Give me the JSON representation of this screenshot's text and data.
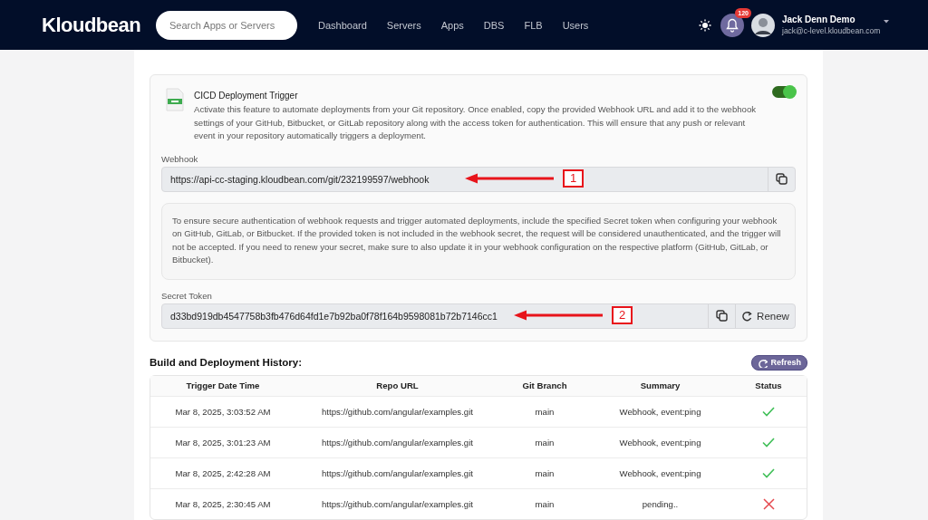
{
  "header": {
    "logo": "Kloudbean",
    "search": {
      "placeholder": "Search Apps or Servers"
    },
    "nav": [
      {
        "label": "Dashboard"
      },
      {
        "label": "Servers"
      },
      {
        "label": "Apps"
      },
      {
        "label": "DBS"
      },
      {
        "label": "FLB"
      },
      {
        "label": "Users"
      }
    ],
    "notifications": {
      "count": "120"
    },
    "user": {
      "name": "Jack Denn Demo",
      "email": "jack@c-level.kloudbean.com"
    }
  },
  "trigger": {
    "title": "CICD Deployment Trigger",
    "description": "Activate this feature to automate deployments from your Git repository. Once enabled, copy the provided Webhook URL and add it to the webhook settings of your GitHub, Bitbucket, or GitLab repository along with the access token for authentication. This will ensure that any push or relevant event in your repository automatically triggers a deployment.",
    "on": true,
    "webhook": {
      "label": "Webhook",
      "value": "https://api-cc-staging.kloudbean.com/git/232199597/webhook",
      "annotation": "1"
    },
    "info": "To ensure secure authentication of webhook requests and trigger automated deployments, include the specified Secret token when configuring your webhook on GitHub, GitLab, or Bitbucket. If the provided token is not included in the webhook secret, the request will be considered unauthenticated, and the trigger will not be accepted. If you need to renew your secret, make sure to also update it in your webhook configuration on the respective platform (GitHub, GitLab, or Bitbucket).",
    "secret": {
      "label": "Secret Token",
      "value": "d33bd919db4547758b3fb476d64fd1e7b92ba0f78f164b9598081b72b7146cc1",
      "annotation": "2",
      "renew_button": "Renew"
    }
  },
  "history": {
    "title": "Build and Deployment History:",
    "refresh_button": "Refresh",
    "columns": [
      "Trigger Date Time",
      "Repo URL",
      "Git Branch",
      "Summary",
      "Status"
    ],
    "rows": [
      {
        "time": "Mar 8, 2025, 3:03:52 AM",
        "repo": "https://github.com/angular/examples.git",
        "branch": "main",
        "summary": "Webhook, event:ping",
        "success": true
      },
      {
        "time": "Mar 8, 2025, 3:01:23 AM",
        "repo": "https://github.com/angular/examples.git",
        "branch": "main",
        "summary": "Webhook, event:ping",
        "success": true
      },
      {
        "time": "Mar 8, 2025, 2:42:28 AM",
        "repo": "https://github.com/angular/examples.git",
        "branch": "main",
        "summary": "Webhook, event:ping",
        "success": true
      },
      {
        "time": "Mar 8, 2025, 2:30:45 AM",
        "repo": "https://github.com/angular/examples.git",
        "branch": "main",
        "summary": "pending..",
        "success": false
      }
    ]
  }
}
